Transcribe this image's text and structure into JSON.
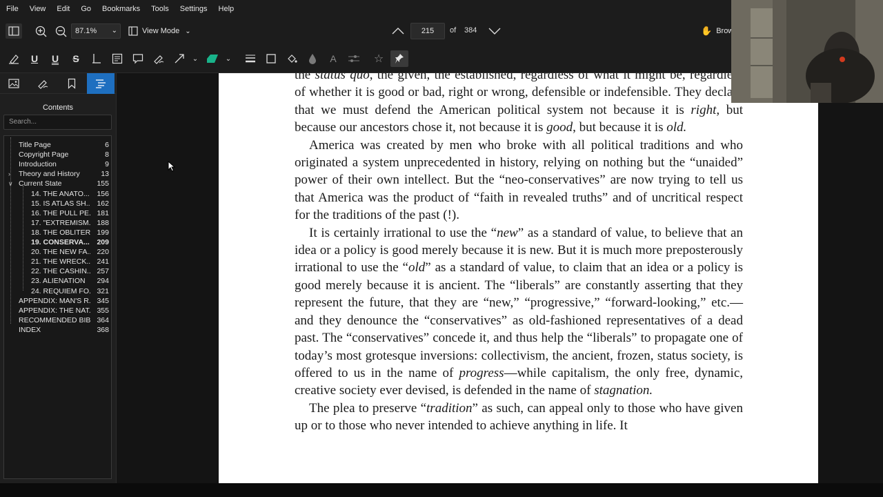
{
  "menubar": [
    "File",
    "View",
    "Edit",
    "Go",
    "Bookmarks",
    "Tools",
    "Settings",
    "Help"
  ],
  "toolbar": {
    "zoom_value": "87.1%",
    "view_mode_label": "View Mode",
    "current_page": "215",
    "of_label": "of",
    "total_pages": "384",
    "browse_label": "Brow"
  },
  "sidebar": {
    "title": "Contents",
    "search_placeholder": "Search...",
    "toc": [
      {
        "label": "Title Page",
        "page": "6",
        "level": 0
      },
      {
        "label": "Copyright Page",
        "page": "8",
        "level": 0
      },
      {
        "label": "Introduction",
        "page": "9",
        "level": 0
      },
      {
        "label": "Theory and History",
        "page": "13",
        "level": 0,
        "twist": "collapsed"
      },
      {
        "label": "Current State",
        "page": "155",
        "level": 0,
        "twist": "expanded"
      },
      {
        "label": "14. THE ANATO...",
        "page": "156",
        "level": 1
      },
      {
        "label": "15. IS ATLAS SH...",
        "page": "162",
        "level": 1
      },
      {
        "label": "16. THE PULL PE...",
        "page": "181",
        "level": 1
      },
      {
        "label": "17. \"EXTREMISM...",
        "page": "188",
        "level": 1
      },
      {
        "label": "18. THE OBLITER...",
        "page": "199",
        "level": 1
      },
      {
        "label": "19. CONSERVA...",
        "page": "209",
        "level": 1,
        "bold": true
      },
      {
        "label": "20. THE NEW FA...",
        "page": "220",
        "level": 1
      },
      {
        "label": "21. THE WRECK...",
        "page": "241",
        "level": 1
      },
      {
        "label": "22. THE CASHIN...",
        "page": "257",
        "level": 1
      },
      {
        "label": "23. ALIENATION",
        "page": "294",
        "level": 1
      },
      {
        "label": "24. REQUIEM FO...",
        "page": "321",
        "level": 1
      },
      {
        "label": "APPENDIX: MAN'S R...",
        "page": "345",
        "level": 0
      },
      {
        "label": "APPENDIX: THE NAT...",
        "page": "355",
        "level": 0
      },
      {
        "label": "RECOMMENDED BIB...",
        "page": "364",
        "level": 0
      },
      {
        "label": "INDEX",
        "page": "368",
        "level": 0
      }
    ]
  },
  "document": {
    "p0_a": "the ",
    "p0_b": "status quo",
    "p0_c": ", the given, the established, regardless of what it might be, regardless of whether it is good or bad, right or wrong, defensible or indefensible. They declare that we must defend the American political system not because it is ",
    "p0_d": "right,",
    "p0_e": " but because our ancestors chose it, not because it is ",
    "p0_f": "good",
    "p0_g": ", but because it is ",
    "p0_h": "old.",
    "p1": "America was created by men who broke with all political traditions and who originated a system unprecedented in history, relying on nothing but the “unaided” power of their own intellect. But the “neo-conservatives” are now trying to tell us that America was the product of “faith in revealed truths” and of uncritical respect for the traditions of the past (!).",
    "p2_a": "It is certainly irrational to use the “",
    "p2_b": "new",
    "p2_c": "” as a standard of value, to believe that an idea or a policy is good merely because it is new. But it is much more preposterously irrational to use the “",
    "p2_d": "old",
    "p2_e": "” as a standard of value, to claim that an idea or a policy is good merely because it is ancient. The “liberals” are constantly asserting that they represent the future, that they are “new,” “progressive,” “forward-looking,” etc.—and they denounce the “conservatives” as old-fashioned representatives of a dead past. The “conservatives” concede it, and thus help the “liberals” to propagate one of today’s most grotesque inversions: collectivism, the ancient, frozen, status society, is offered to us in the name of ",
    "p2_f": "progress",
    "p2_g": "—while capitalism, the only free, dynamic, creative society ever devised, is defended in the name of ",
    "p2_h": "stagnation.",
    "p3_a": "The plea to preserve “",
    "p3_b": "tradition",
    "p3_c": "” as such, can appeal only to those who have given up or to those who never intended to achieve anything in life. It"
  },
  "colors": {
    "accent": "#1e6fc0",
    "highlighter": "#19b38a",
    "background": "#1c1c1c"
  }
}
